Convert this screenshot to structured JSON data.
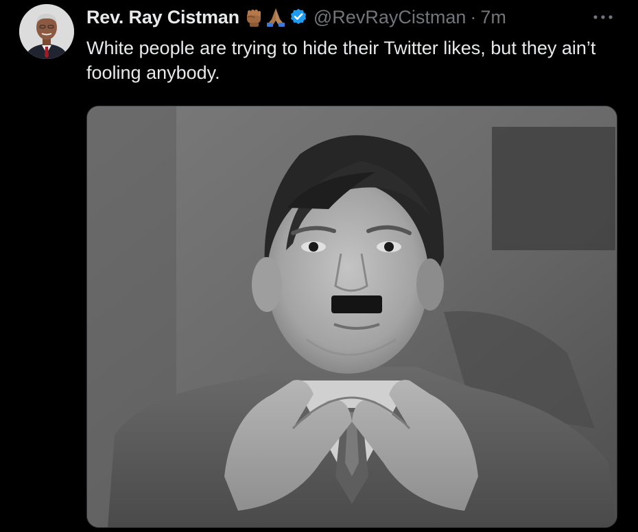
{
  "author": {
    "display_name": "Rev. Ray Cistman",
    "handle": "@RevRayCistman",
    "separator": "·",
    "timestamp": "7m",
    "badges": [
      "raised-fist-emoji",
      "folded-hands-emoji",
      "verified-badge-icon"
    ]
  },
  "tweet": {
    "text": "White people are trying to hide their Twitter likes, but they ain’t fooling anybody."
  },
  "more_menu": {
    "label": "•••"
  },
  "colors": {
    "background": "#000000",
    "primary_text": "#e7e9ea",
    "secondary_text": "#71767b",
    "verified_blue": "#1d9bf0",
    "border": "#2f3336"
  }
}
